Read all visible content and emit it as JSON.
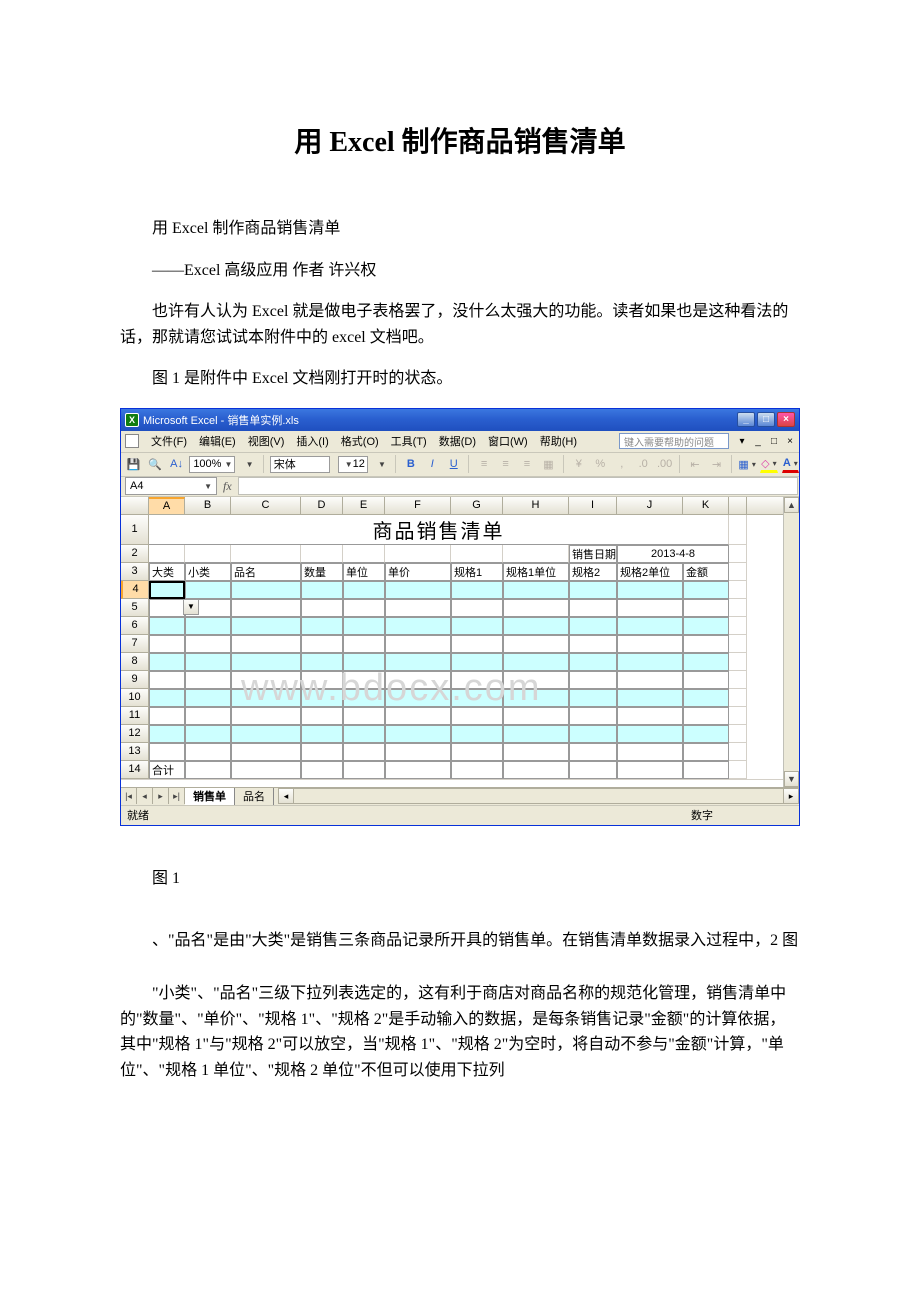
{
  "doc": {
    "title": "用 Excel 制作商品销售清单",
    "p1": "用 Excel 制作商品销售清单",
    "p2": "——Excel 高级应用 作者 许兴权",
    "p3": "也许有人认为 Excel 就是做电子表格罢了，没什么太强大的功能。读者如果也是这种看法的话，那就请您试试本附件中的 excel 文档吧。",
    "p4": "图 1 是附件中 Excel 文档刚打开时的状态。",
    "fig1_label": "图 1",
    "p5": "、\"品名\"是由\"大类\"是销售三条商品记录所开具的销售单。在销售清单数据录入过程中，2 图",
    "p6": "\"小类\"、\"品名\"三级下拉列表选定的，这有利于商店对商品名称的规范化管理，销售清单中的\"数量\"、\"单价\"、\"规格 1\"、\"规格 2\"是手动输入的数据，是每条销售记录\"金额\"的计算依据，其中\"规格 1\"与\"规格 2\"可以放空，当\"规格 1\"、\"规格 2\"为空时，将自动不参与\"金额\"计算，\"单位\"、\"规格 1 单位\"、\"规格 2 单位\"不但可以使用下拉列"
  },
  "excel": {
    "title": "Microsoft Excel - 销售单实例.xls",
    "menu": {
      "file": "文件(F)",
      "edit": "编辑(E)",
      "view": "视图(V)",
      "insert": "插入(I)",
      "format": "格式(O)",
      "tools": "工具(T)",
      "data": "数据(D)",
      "window": "窗口(W)",
      "help": "帮助(H)",
      "help_ph": "键入需要帮助的问题"
    },
    "tools": {
      "zoom": "100%",
      "font": "宋体",
      "size": "12"
    },
    "namebox": "A4",
    "cols": [
      "A",
      "B",
      "C",
      "D",
      "E",
      "F",
      "G",
      "H",
      "I",
      "J",
      "K",
      ""
    ],
    "sheet_title": "商品销售清单",
    "row2": {
      "sale_date_lbl": "销售日期",
      "sale_date_val": "2013-4-8"
    },
    "headers": {
      "A": "大类",
      "B": "小类",
      "C": "品名",
      "D": "数量",
      "E": "单位",
      "F": "单价",
      "G": "规格1",
      "H": "规格1单位",
      "I": "规格2",
      "J": "规格2单位",
      "K": "金额"
    },
    "total_row": {
      "label": "合计"
    },
    "tabs": {
      "t1": "销售单",
      "t2": "品名"
    },
    "status": {
      "left": "就绪",
      "right": "数字"
    }
  }
}
